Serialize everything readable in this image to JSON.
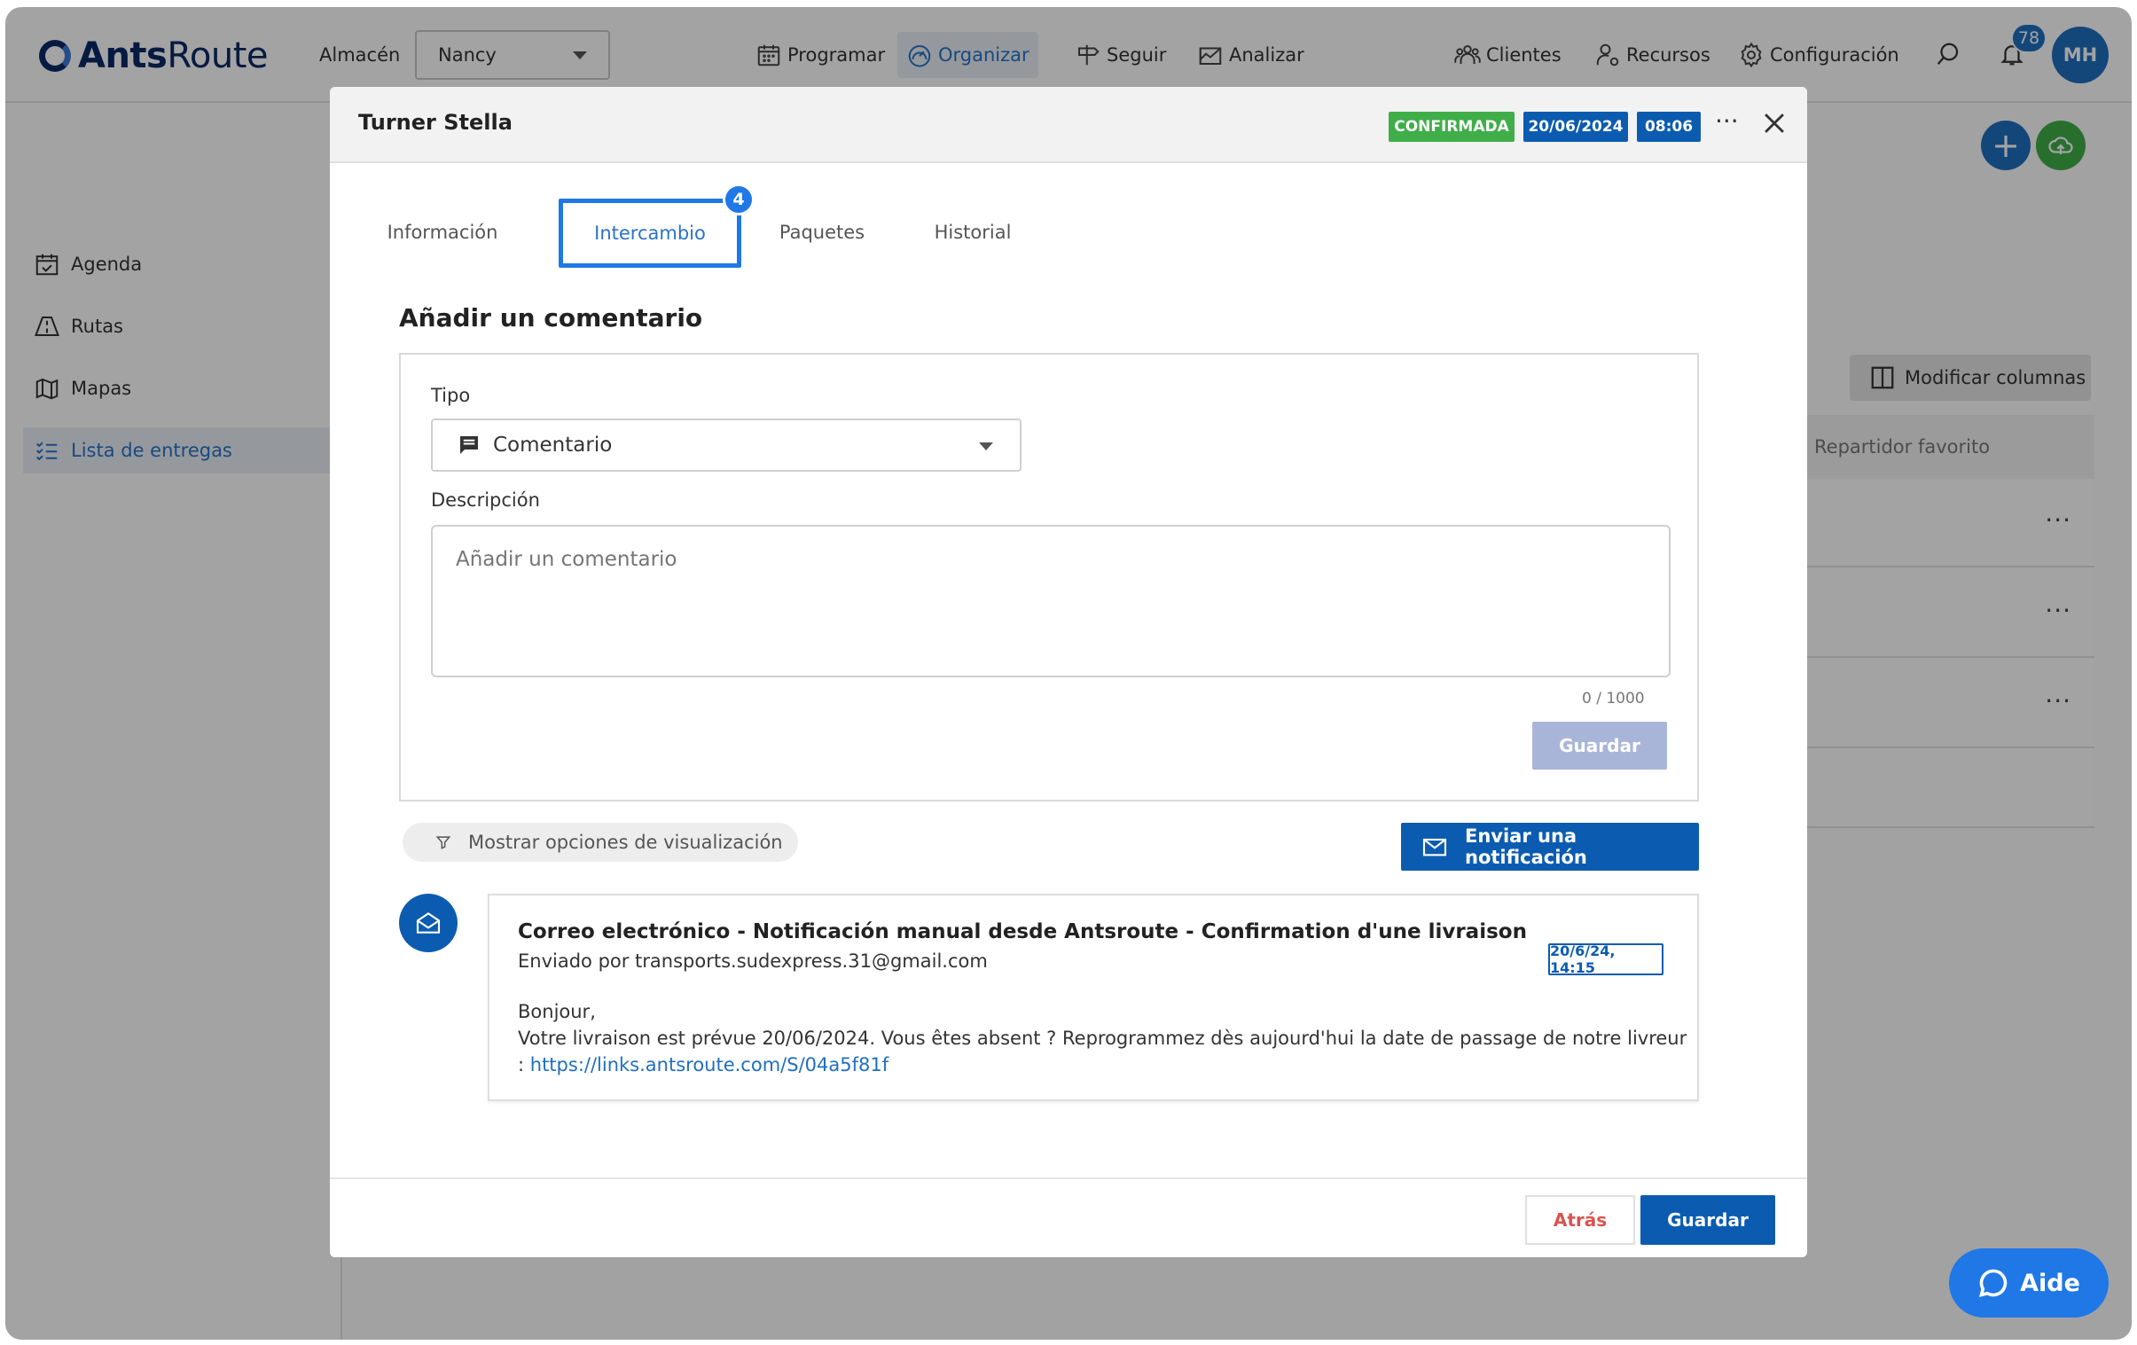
{
  "app": {
    "brand_bold": "Ants",
    "brand_rest": "Route"
  },
  "topbar": {
    "warehouse_label": "Almacén",
    "warehouse_value": "Nancy",
    "nav": [
      {
        "label": "Programar",
        "icon": "calendar-grid-icon"
      },
      {
        "label": "Organizar",
        "icon": "speedometer-icon",
        "active": true
      },
      {
        "label": "Seguir",
        "icon": "signpost-icon"
      },
      {
        "label": "Analizar",
        "icon": "chart-icon"
      }
    ],
    "right_nav": [
      {
        "label": "Clientes",
        "icon": "clients-icon"
      },
      {
        "label": "Recursos",
        "icon": "resources-icon"
      },
      {
        "label": "Configuración",
        "icon": "gear-icon"
      }
    ],
    "notification_count": "78",
    "avatar_initials": "MH"
  },
  "sidebar": {
    "items": [
      {
        "label": "Agenda",
        "icon": "calendar-check-icon"
      },
      {
        "label": "Rutas",
        "icon": "routes-icon"
      },
      {
        "label": "Mapas",
        "icon": "map-icon"
      },
      {
        "label": "Lista de entregas",
        "icon": "checklist-icon",
        "active": true
      }
    ]
  },
  "background_page": {
    "modify_columns_label": "Modificar columnas",
    "column_header": "Repartidor favorito"
  },
  "modal": {
    "title": "Turner Stella",
    "status": "CONFIRMADA",
    "date": "20/06/2024",
    "time": "08:06",
    "tabs": [
      {
        "label": "Información"
      },
      {
        "label": "Intercambio",
        "active": true,
        "badge": "4"
      },
      {
        "label": "Paquetes"
      },
      {
        "label": "Historial"
      }
    ],
    "add_comment": {
      "title": "Añadir un comentario",
      "type_label": "Tipo",
      "type_value": "Comentario",
      "description_label": "Descripción",
      "description_placeholder": "Añadir un comentario",
      "counter": "0 / 1000",
      "save_label": "Guardar"
    },
    "display_options_label": "Mostrar opciones de visualización",
    "send_notification_label": "Enviar una notificación",
    "message": {
      "subject": "Correo electrónico - Notificación manual desde Antsroute - Confirmation d'une livraison",
      "sender": "Enviado por transports.sudexpress.31@gmail.com",
      "date": "20/6/24, 14:15",
      "greeting": "Bonjour,",
      "body": "Votre livraison est prévue 20/06/2024. Vous êtes absent ? Reprogrammez dès aujourd'hui la date de passage de notre livreur",
      "link_prefix": ": ",
      "link": "https://links.antsroute.com/S/04a5f81f"
    },
    "footer": {
      "back_label": "Atrás",
      "save_label": "Guardar"
    }
  },
  "help": {
    "label": "Aide"
  },
  "colors": {
    "primary": "#0b5cb0",
    "confirmed_green": "#3fae49",
    "tab_active": "#1f78e6",
    "danger": "#d9534f"
  }
}
